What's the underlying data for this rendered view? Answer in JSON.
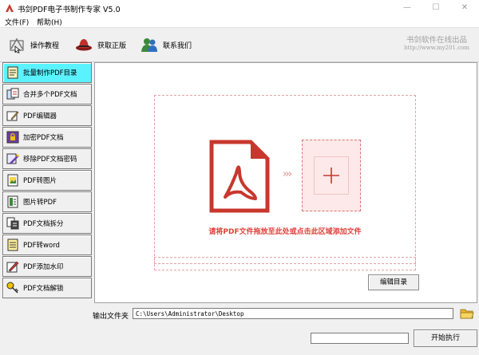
{
  "window": {
    "title": "书剑PDF电子书制作专家 V5.0",
    "minimize": "—",
    "maximize": "☐",
    "close": "✕"
  },
  "menu": [
    {
      "label": "文件(F)"
    },
    {
      "label": "帮助(H)"
    }
  ],
  "toolbar": {
    "tutorial": "操作教程",
    "get_license": "获取正版",
    "contact": "联系我们"
  },
  "brand": {
    "name": "书剑软件在线出品",
    "url": "http://www.my201.com"
  },
  "sidebar": {
    "items": [
      {
        "label": "批量制作PDF目录",
        "icon": "document-list-icon",
        "active": true
      },
      {
        "label": "合并多个PDF文档",
        "icon": "merge-documents-icon"
      },
      {
        "label": "PDF编辑器",
        "icon": "edit-icon"
      },
      {
        "label": "加密PDF文档",
        "icon": "lock-icon"
      },
      {
        "label": "移除PDF文档密码",
        "icon": "unlock-icon"
      },
      {
        "label": "PDF转图片",
        "icon": "image-icon"
      },
      {
        "label": "图片转PDF",
        "icon": "document-icon"
      },
      {
        "label": "PDF文档拆分",
        "icon": "split-icon"
      },
      {
        "label": "PDF转word",
        "icon": "note-icon"
      },
      {
        "label": "PDF添加水印",
        "icon": "watermark-icon"
      },
      {
        "label": "PDF文档解锁",
        "icon": "key-icon"
      }
    ]
  },
  "main": {
    "drop_hint": "请将PDF文件拖放至此处或点击此区域添加文件",
    "edit_button": "编辑目录"
  },
  "output": {
    "label": "输出文件夹",
    "path": "C:\\Users\\Administrator\\Desktop"
  },
  "actions": {
    "start_button": "开始执行",
    "progress": 0
  },
  "colors": {
    "accent_red": "#c8372d",
    "active_tab": "#5af2ff",
    "hint_red": "#e0413a"
  }
}
